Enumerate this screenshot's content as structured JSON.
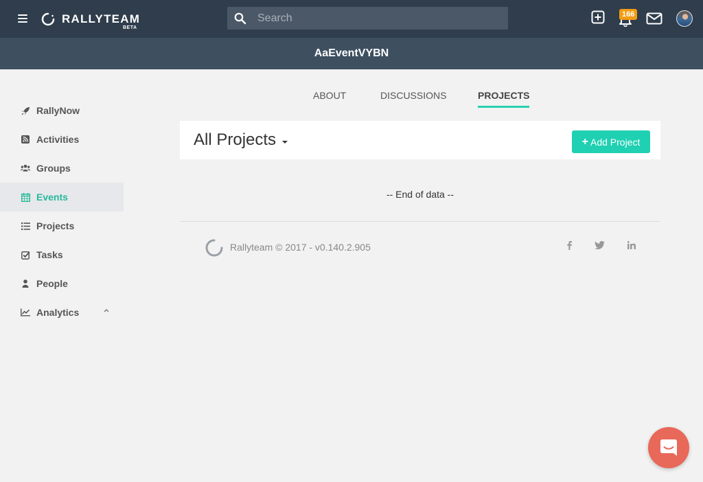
{
  "app": {
    "logo_text": "RALLYTEAM",
    "logo_badge": "BETA"
  },
  "search": {
    "placeholder": "Search",
    "value": ""
  },
  "notifications": {
    "count": "166"
  },
  "header": {
    "title": "AaEventVYBN"
  },
  "sidebar": {
    "items": [
      {
        "label": "RallyNow",
        "icon": "rocket-icon"
      },
      {
        "label": "Activities",
        "icon": "rss-icon"
      },
      {
        "label": "Groups",
        "icon": "users-icon"
      },
      {
        "label": "Events",
        "icon": "calendar-icon",
        "active": true
      },
      {
        "label": "Projects",
        "icon": "list-icon"
      },
      {
        "label": "Tasks",
        "icon": "checkbox-icon"
      },
      {
        "label": "People",
        "icon": "user-icon"
      },
      {
        "label": "Analytics",
        "icon": "line-chart-icon"
      }
    ]
  },
  "tabs": [
    {
      "label": "ABOUT"
    },
    {
      "label": "DISCUSSIONS"
    },
    {
      "label": "PROJECTS",
      "active": true
    }
  ],
  "projects": {
    "filter_label": "All Projects",
    "add_button_label": "Add Project",
    "end_of_data": "-- End of data --"
  },
  "footer": {
    "copyright": "Rallyteam © 2017 - v0.140.2.905"
  },
  "colors": {
    "topbar": "#2f3d4c",
    "subheader": "#3e4f60",
    "accent": "#1fd0b2",
    "badge": "#f39c12",
    "chat": "#e8685a"
  }
}
